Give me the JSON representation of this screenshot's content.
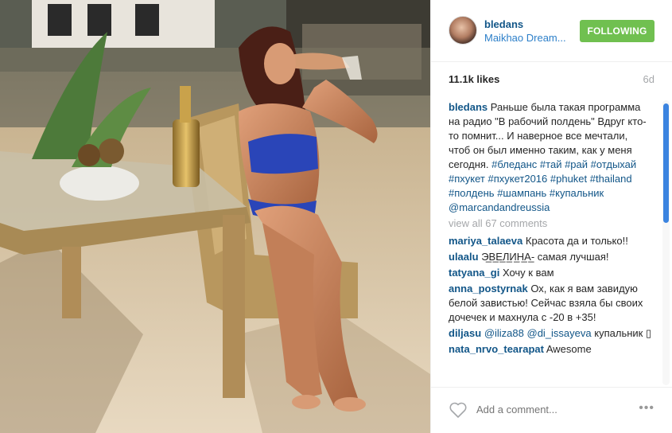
{
  "post": {
    "username": "bledans",
    "location": "Maikhao Dream...",
    "follow_label": "FOLLOWING",
    "likes": "11.1k likes",
    "age": "6d"
  },
  "caption": {
    "user": "bledans",
    "text": "Раньше была такая программа на радио \"В рабочий полдень\" Вдруг кто-то помнит... И наверное все мечтали, чтоб он был именно таким, как у меня сегодня.",
    "tags": [
      "#бледанс",
      "#тай",
      "#рай",
      "#отдыхай",
      "#пхукет",
      "#пхукет2016",
      "#phuket",
      "#thailand",
      "#полдень",
      "#шампань",
      "#купальник"
    ],
    "mention": "@marcandandreussia"
  },
  "view_all": "view all 67 comments",
  "comments": [
    {
      "user": "mariya_talaeva",
      "text": "Красота да и только!!"
    },
    {
      "user": "ulaalu",
      "text": "Э̲В̲Е̲Л̲И̲Н̲А̲- самая лучшая!"
    },
    {
      "user": "tatyana_gi",
      "text": "Хочу к вам"
    },
    {
      "user": "anna_postyrnak",
      "text": "Ох, как я вам завидую белой завистью! Сейчас взяла бы своих дочечек и махнула с -20 в +35!"
    },
    {
      "user": "diljasu",
      "mention1": "@iliza88",
      "mention2": "@di_issayeva",
      "text": "купальник ▯"
    },
    {
      "user": "nata_nrvo_tearapat",
      "text": "Awesome"
    }
  ],
  "footer": {
    "placeholder": "Add a comment...",
    "more": "•••"
  },
  "colors": {
    "link": "#125688",
    "follow_bg": "#70c050",
    "muted": "#a5a7aa"
  }
}
